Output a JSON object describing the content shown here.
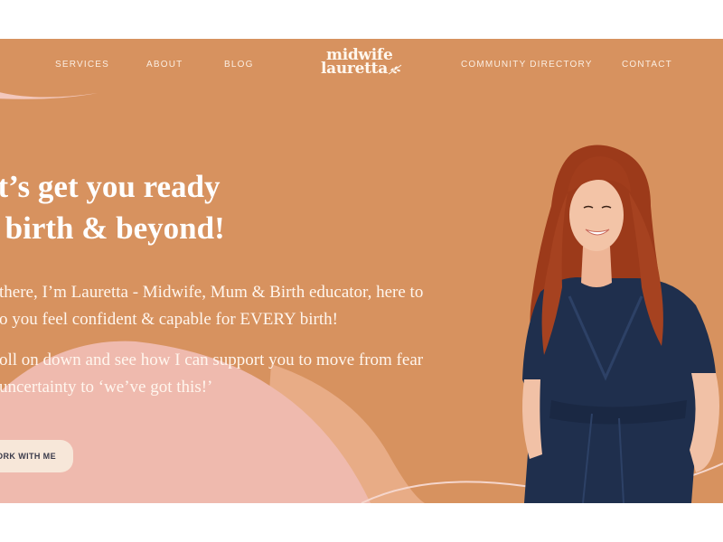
{
  "nav": {
    "services": "SERVICES",
    "about": "ABOUT",
    "blog": "BLOG",
    "community_directory": "COMMUNITY DIRECTORY",
    "contact": "CONTACT"
  },
  "logo": {
    "line1": "midwife",
    "line2": "lauretta"
  },
  "hero": {
    "headline_line1": "et’s get you ready",
    "headline_line2": "r birth & beyond!",
    "para1_line1": "there, I’m Lauretta - Midwife, Mum & Birth educator, here to",
    "para1_line2": "o you feel confident & capable for EVERY birth!",
    "para2_line1": "oll on down and see how I can support you to move from fear",
    "para2_line2": "uncertainty to ‘we’ve got this!’",
    "cta_label": "ORK WITH ME"
  },
  "colors": {
    "background": "#d7925f",
    "pink_blob": "#efbaae",
    "peach_blob": "#e8ac86",
    "text": "#ffffff",
    "cta_bg": "#f7e7d9",
    "dress": "#1f2f4d",
    "hair": "#a13d1c"
  },
  "icons": {
    "logo_leaf": "leaf-sprig-icon"
  }
}
